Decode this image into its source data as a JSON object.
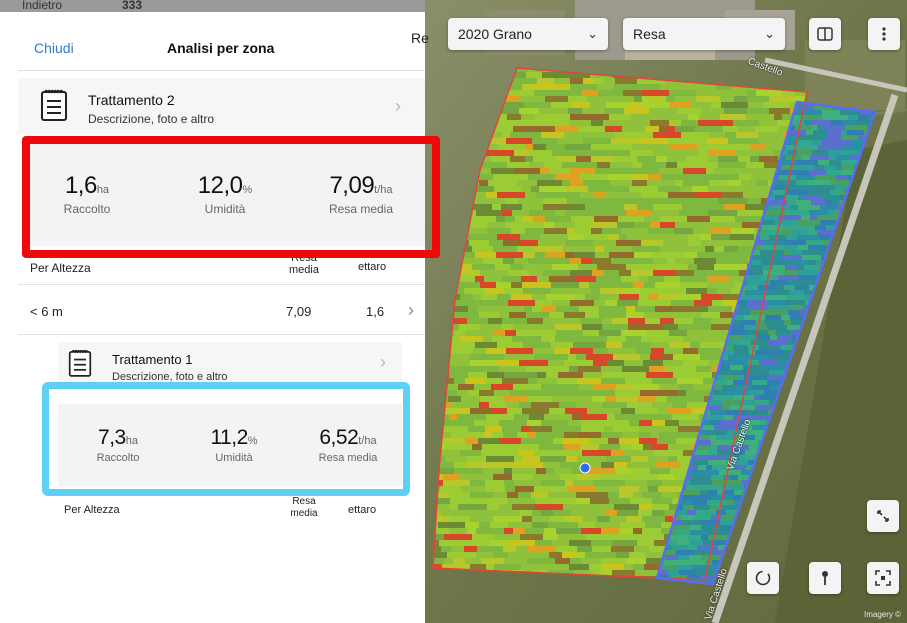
{
  "background_strip": {
    "text_left": "Indietro",
    "text_number": "333"
  },
  "panel": {
    "close_label": "Chiudi",
    "title": "Analisi per zona",
    "partial_right_text": "Re"
  },
  "treatment_2": {
    "title": "Trattamento 2",
    "subtitle": "Descrizione, foto e altro",
    "stats": [
      {
        "value": "1,6",
        "unit": "ha",
        "label": "Raccolto"
      },
      {
        "value": "12,0",
        "unit": "%",
        "label": "Umidità"
      },
      {
        "value": "7,09",
        "unit": "t/ha",
        "label": "Resa media"
      }
    ],
    "table": {
      "col_group": "Per Altezza",
      "col_yield": "Resa media",
      "col_area": "ettaro",
      "rows": [
        {
          "group": "< 6 m",
          "yield": "7,09",
          "area": "1,6"
        }
      ]
    }
  },
  "treatment_1": {
    "title": "Trattamento 1",
    "subtitle": "Descrizione, foto e altro",
    "stats": [
      {
        "value": "7,3",
        "unit": "ha",
        "label": "Raccolto"
      },
      {
        "value": "11,2",
        "unit": "%",
        "label": "Umidità"
      },
      {
        "value": "6,52",
        "unit": "t/ha",
        "label": "Resa media"
      }
    ],
    "table": {
      "col_group": "Per Altezza",
      "col_yield": "Resa media",
      "col_area": "ettaro"
    }
  },
  "map": {
    "season_select": "2020 Grano",
    "layer_select": "Resa",
    "street_labels": [
      "Via Castello",
      "Via Castello",
      "Castello"
    ],
    "credit": "Imagery ©"
  },
  "colors": {
    "highlight_red": "#ee0a0a",
    "highlight_blue": "#5ed0f4",
    "link_blue": "#2d7ad4"
  },
  "icons": [
    "notepad-icon",
    "chevron-right-icon",
    "chevron-down-icon",
    "split-view-icon",
    "more-vertical-icon",
    "expand-icon",
    "lasso-icon",
    "pin-icon",
    "focus-frame-icon"
  ]
}
